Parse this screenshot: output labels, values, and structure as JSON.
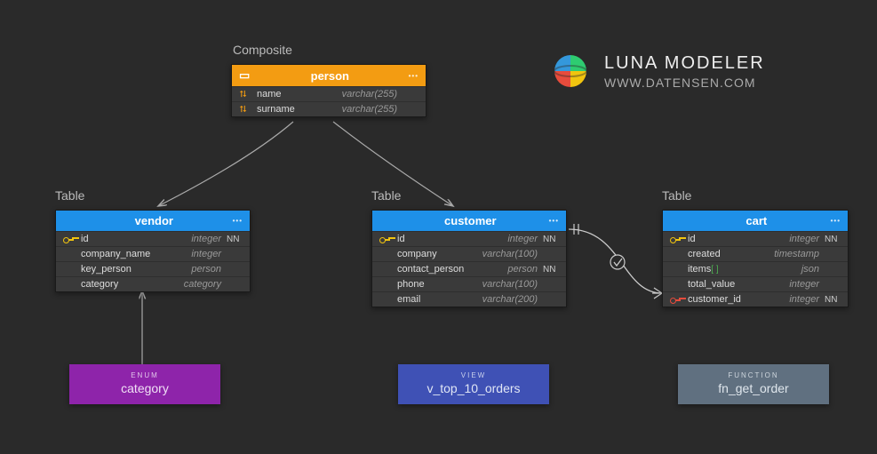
{
  "branding": {
    "title": "LUNA MODELER",
    "url": "WWW.DATENSEN.COM"
  },
  "labels": {
    "composite": "Composite",
    "table": "Table"
  },
  "entities": {
    "person": {
      "title": "person",
      "rows": [
        {
          "icon": "fk",
          "name": "name",
          "type": "varchar(255)",
          "constraint": ""
        },
        {
          "icon": "fk",
          "name": "surname",
          "type": "varchar(255)",
          "constraint": ""
        }
      ]
    },
    "vendor": {
      "title": "vendor",
      "rows": [
        {
          "icon": "pk",
          "name": "id",
          "type": "integer",
          "constraint": "NN"
        },
        {
          "icon": "",
          "name": "company_name",
          "type": "integer",
          "constraint": ""
        },
        {
          "icon": "",
          "name": "key_person",
          "type": "person",
          "constraint": ""
        },
        {
          "icon": "",
          "name": "category",
          "type": "category",
          "constraint": ""
        }
      ]
    },
    "customer": {
      "title": "customer",
      "rows": [
        {
          "icon": "pk",
          "name": "id",
          "type": "integer",
          "constraint": "NN"
        },
        {
          "icon": "",
          "name": "company",
          "type": "varchar(100)",
          "constraint": ""
        },
        {
          "icon": "",
          "name": "contact_person",
          "type": "person",
          "constraint": "NN"
        },
        {
          "icon": "",
          "name": "phone",
          "type": "varchar(100)",
          "constraint": ""
        },
        {
          "icon": "",
          "name": "email",
          "type": "varchar(200)",
          "constraint": ""
        }
      ]
    },
    "cart": {
      "title": "cart",
      "rows": [
        {
          "icon": "pk",
          "name": "id",
          "type": "integer",
          "constraint": "NN"
        },
        {
          "icon": "",
          "name": "created",
          "type": "timestamp",
          "constraint": ""
        },
        {
          "icon": "",
          "name": "items",
          "suffix": "[ ]",
          "type": "json",
          "constraint": ""
        },
        {
          "icon": "",
          "name": "total_value",
          "type": "integer",
          "constraint": ""
        },
        {
          "icon": "pkred",
          "name": "customer_id",
          "type": "integer",
          "constraint": "NN"
        }
      ]
    }
  },
  "chips": {
    "category": {
      "kind": "ENUM",
      "name": "category"
    },
    "view": {
      "kind": "VIEW",
      "name": "v_top_10_orders"
    },
    "function": {
      "kind": "FUNCTION",
      "name": "fn_get_order"
    }
  }
}
